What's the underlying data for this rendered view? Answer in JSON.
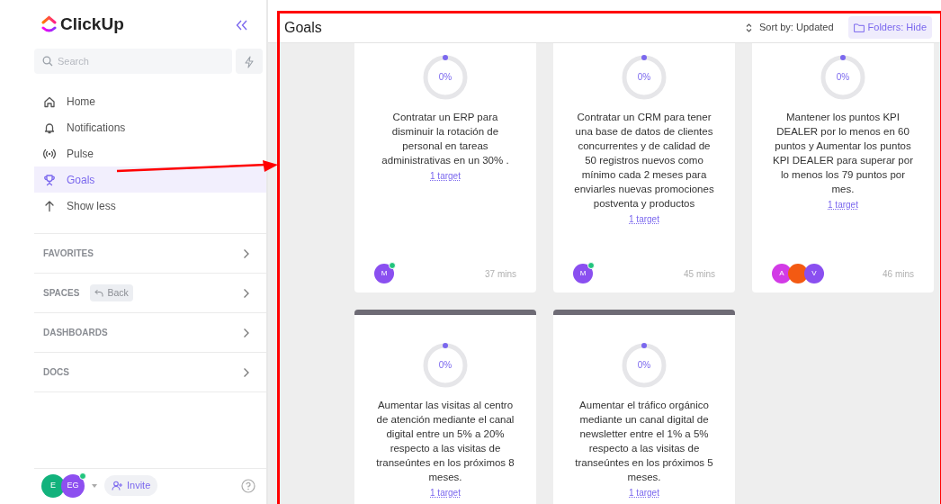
{
  "sidebar": {
    "logo": "ClickUp",
    "search": {
      "placeholder": "Search"
    },
    "nav": [
      {
        "kind": "home",
        "label": "Home",
        "selected": false
      },
      {
        "kind": "bell",
        "label": "Notifications",
        "selected": false
      },
      {
        "kind": "pulse",
        "label": "Pulse",
        "selected": false
      },
      {
        "kind": "trophy",
        "label": "Goals",
        "selected": true
      },
      {
        "kind": "up",
        "label": "Show less",
        "selected": false
      }
    ],
    "sections": [
      {
        "label": "FAVORITES"
      },
      {
        "label": "SPACES",
        "tag": "Back"
      },
      {
        "label": "DASHBOARDS"
      },
      {
        "label": "DOCS"
      }
    ],
    "footer": {
      "avatars": [
        {
          "initials": "E",
          "color": "#12b27c"
        },
        {
          "initials": "EG",
          "color": "#8d4ff0",
          "online": true
        }
      ],
      "invite": "Invite"
    }
  },
  "header": {
    "title": "Goals",
    "sort": "Sort by: Updated",
    "folders": "Folders: Hide"
  },
  "goals": [
    {
      "progress": "0%",
      "title": "Contratar un ERP para disminuir la rotación de personal en tareas administrativas en un 30% .",
      "targets": "1 target",
      "members": [
        {
          "initials": "M",
          "color": "#8a4ff0",
          "online": true
        }
      ],
      "updated": "37 mins"
    },
    {
      "progress": "0%",
      "title": "Contratar un CRM para tener una base de datos de clientes concurrentes y de calidad de 50 registros nuevos como mínimo cada 2 meses para enviarles nuevas promociones postventa y productos",
      "targets": "1 target",
      "members": [
        {
          "initials": "M",
          "color": "#8a4ff0",
          "online": true
        }
      ],
      "updated": "45 mins"
    },
    {
      "progress": "0%",
      "title": "Mantener los puntos KPI DEALER por lo menos en 60 puntos y Aumentar los puntos KPI DEALER para superar por lo menos los 79 puntos por mes.",
      "targets": "1 target",
      "members": [
        {
          "initials": "A",
          "color": "#d23be6"
        },
        {
          "color": "#f35a12"
        },
        {
          "initials": "V",
          "color": "#8a4ff0"
        }
      ],
      "updated": "46 mins"
    },
    {
      "progress": "0%",
      "color": "#6e6b75",
      "title": "Aumentar las visitas al centro de atención mediante el canal digital entre un 5% a 20% respecto a las visitas de transeúntes en los próximos 8 meses.",
      "targets": "1 target"
    },
    {
      "progress": "0%",
      "color": "#6e6b75",
      "title": "Aumentar el tráfico orgánico mediante un canal digital de newsletter entre el 1% a 5% respecto a las visitas de transeúntes en los próximos 5 meses.",
      "targets": "1 target"
    }
  ]
}
